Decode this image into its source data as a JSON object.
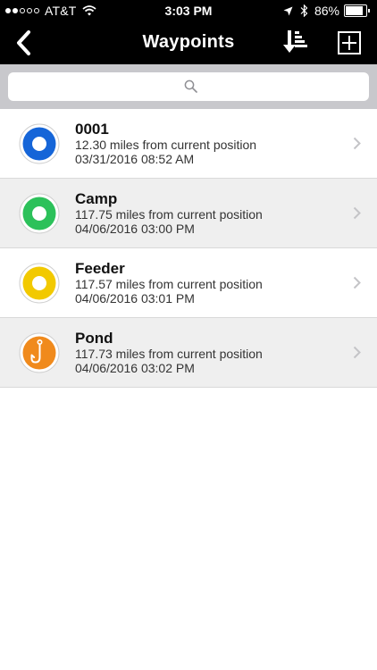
{
  "status_bar": {
    "carrier": "AT&T",
    "time": "3:03 PM",
    "battery_percent": "86%",
    "battery_level": 0.86,
    "signal_filled": 2,
    "signal_total": 5
  },
  "nav": {
    "title": "Waypoints",
    "back_icon": "chevron-left-icon",
    "sort_icon": "sort-icon",
    "add_icon": "plus-icon"
  },
  "search": {
    "placeholder": "",
    "icon": "search-icon"
  },
  "waypoints": [
    {
      "name": "0001",
      "distance": "12.30 miles from current position",
      "date": "03/31/2016 08:52 AM",
      "marker": "blue-ring-icon",
      "color": "#1565d8"
    },
    {
      "name": "Camp",
      "distance": "117.75 miles from current position",
      "date": "04/06/2016 03:00 PM",
      "marker": "green-ring-icon",
      "color": "#2cc15a"
    },
    {
      "name": "Feeder",
      "distance": "117.57 miles from current position",
      "date": "04/06/2016 03:01 PM",
      "marker": "yellow-ring-icon",
      "color": "#f2c900"
    },
    {
      "name": "Pond",
      "distance": "117.73 miles from current position",
      "date": "04/06/2016 03:02 PM",
      "marker": "fish-hook-icon",
      "color": "#f08a1c"
    }
  ]
}
